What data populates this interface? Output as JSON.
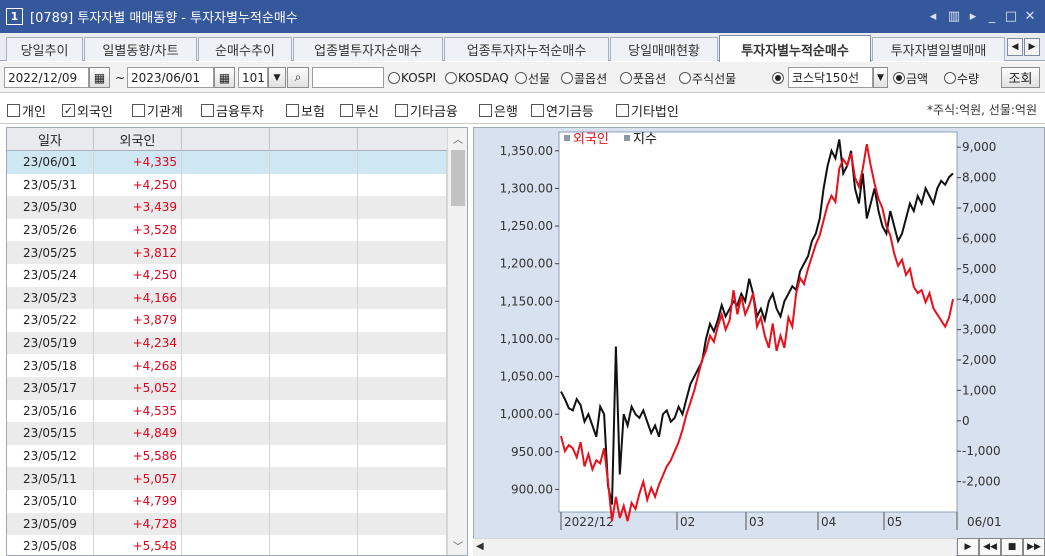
{
  "window": {
    "number": "1",
    "title": "[0789] 투자자별 매매동향 - 투자자별누적순매수",
    "controls": [
      "◂",
      "▥",
      "▸",
      "_",
      "□",
      "✕"
    ]
  },
  "tabs": [
    {
      "label": "당일추이",
      "active": false
    },
    {
      "label": "일별동향/차트",
      "active": false
    },
    {
      "label": "순매수추이",
      "active": false
    },
    {
      "label": "업종별투자자순매수",
      "active": false
    },
    {
      "label": "업종투자자누적순매수",
      "active": false
    },
    {
      "label": "당일매매현황",
      "active": false
    },
    {
      "label": "투자자별누적순매수",
      "active": true
    },
    {
      "label": "투자자별일별매매",
      "active": false
    }
  ],
  "toolbar": {
    "start_date": "2022/12/09",
    "tilde": "~",
    "end_date": "2023/06/01",
    "count": "101",
    "search_value": "",
    "radios": [
      {
        "label": "KOSPI",
        "checked": false
      },
      {
        "label": "KOSDAQ",
        "checked": false
      },
      {
        "label": "선물",
        "checked": false
      },
      {
        "label": "콜옵션",
        "checked": false
      },
      {
        "label": "풋옵션",
        "checked": false
      },
      {
        "label": "주식선물",
        "checked": false
      },
      {
        "label": "",
        "checked": true
      }
    ],
    "index_select": "코스닥150선",
    "mode_radios": [
      {
        "label": "금액",
        "checked": true
      },
      {
        "label": "수량",
        "checked": false
      }
    ],
    "query_button": "조회"
  },
  "filters": {
    "items": [
      {
        "label": "개인",
        "checked": false
      },
      {
        "label": "외국인",
        "checked": true
      },
      {
        "label": "기관계",
        "checked": false
      },
      {
        "label": "금융투자",
        "checked": false
      },
      {
        "label": "보험",
        "checked": false
      },
      {
        "label": "투신",
        "checked": false
      },
      {
        "label": "기타금융",
        "checked": false
      },
      {
        "label": "은행",
        "checked": false
      },
      {
        "label": "연기금등",
        "checked": false
      },
      {
        "label": "기타법인",
        "checked": false
      }
    ],
    "unit_note": "*주식:억원, 선물:억원"
  },
  "table": {
    "headers": [
      "일자",
      "외국인"
    ],
    "rows": [
      {
        "date": "23/06/01",
        "value": "+4,335"
      },
      {
        "date": "23/05/31",
        "value": "+4,250"
      },
      {
        "date": "23/05/30",
        "value": "+3,439"
      },
      {
        "date": "23/05/26",
        "value": "+3,528"
      },
      {
        "date": "23/05/25",
        "value": "+3,812"
      },
      {
        "date": "23/05/24",
        "value": "+4,250"
      },
      {
        "date": "23/05/23",
        "value": "+4,166"
      },
      {
        "date": "23/05/22",
        "value": "+3,879"
      },
      {
        "date": "23/05/19",
        "value": "+4,234"
      },
      {
        "date": "23/05/18",
        "value": "+4,268"
      },
      {
        "date": "23/05/17",
        "value": "+5,052"
      },
      {
        "date": "23/05/16",
        "value": "+4,535"
      },
      {
        "date": "23/05/15",
        "value": "+4,849"
      },
      {
        "date": "23/05/12",
        "value": "+5,586"
      },
      {
        "date": "23/05/11",
        "value": "+5,057"
      },
      {
        "date": "23/05/10",
        "value": "+4,799"
      },
      {
        "date": "23/05/09",
        "value": "+4,728"
      },
      {
        "date": "23/05/08",
        "value": "+5,548"
      }
    ]
  },
  "chart": {
    "legend": [
      {
        "label": "외국인",
        "color": "#e8101b"
      },
      {
        "label": "지수",
        "color": "#111111"
      }
    ],
    "left_ticks": [
      "1,350.00",
      "1,300.00",
      "1,250.00",
      "1,200.00",
      "1,150.00",
      "1,100.00",
      "1,050.00",
      "1,000.00",
      "950.00",
      "900.00"
    ],
    "right_ticks": [
      "9,000",
      "8,000",
      "7,000",
      "6,000",
      "5,000",
      "4,000",
      "3,000",
      "2,000",
      "1,000",
      "0",
      "-1,000",
      "-2,000"
    ],
    "x_ticks": [
      "2022/12",
      "02",
      "03",
      "04",
      "05",
      "06/01"
    ],
    "colors": {
      "bg": "#ffffff",
      "panel": "#d7e1ef",
      "foreign": "#e8101b",
      "index": "#111111"
    }
  },
  "chart_data": {
    "type": "line",
    "x": [
      "2022/12",
      "02",
      "03",
      "04",
      "05",
      "06/01"
    ],
    "yaxis_left": {
      "label": "",
      "ylim": [
        870,
        1375
      ]
    },
    "yaxis_right": {
      "label": "",
      "ylim": [
        -3000,
        9500
      ]
    },
    "series": [
      {
        "name": "지수",
        "axis": "left",
        "values": [
          1030,
          1020,
          1008,
          1005,
          1020,
          1012,
          990,
          1000,
          985,
          970,
          1010,
          1000,
          905,
          880,
          1090,
          920,
          1000,
          985,
          1010,
          1000,
          995,
          1005,
          990,
          975,
          985,
          970,
          1000,
          1005,
          990,
          995,
          1010,
          1000,
          1020,
          1040,
          1050,
          1060,
          1070,
          1100,
          1120,
          1110,
          1125,
          1145,
          1130,
          1140,
          1150,
          1145,
          1160,
          1150,
          1180,
          1160,
          1130,
          1140,
          1125,
          1150,
          1160,
          1140,
          1130,
          1150,
          1160,
          1170,
          1165,
          1190,
          1200,
          1210,
          1230,
          1240,
          1260,
          1300,
          1330,
          1350,
          1340,
          1365,
          1320,
          1330,
          1350,
          1300,
          1280,
          1320,
          1260,
          1280,
          1300,
          1270,
          1250,
          1240,
          1270,
          1250,
          1230,
          1240,
          1260,
          1280,
          1270,
          1290,
          1280,
          1300,
          1290,
          1280,
          1300,
          1310,
          1305,
          1315,
          1320
        ]
      },
      {
        "name": "외국인",
        "axis": "right",
        "values": [
          -500,
          -1000,
          -800,
          -900,
          -1200,
          -700,
          -1500,
          -1100,
          -1600,
          -1300,
          -1400,
          -900,
          -2000,
          -3300,
          -2500,
          -3200,
          -2800,
          -3300,
          -2700,
          -2900,
          -2400,
          -2000,
          -2600,
          -2200,
          -2500,
          -2100,
          -1800,
          -1500,
          -1300,
          -1000,
          -700,
          -300,
          200,
          600,
          1000,
          1500,
          2000,
          2300,
          2800,
          2600,
          3100,
          3500,
          3000,
          3300,
          4300,
          3500,
          4100,
          3500,
          3800,
          4200,
          3100,
          3400,
          2800,
          2400,
          3200,
          2300,
          2800,
          2400,
          3400,
          3100,
          4200,
          4700,
          4500,
          5000,
          5400,
          5800,
          6100,
          6600,
          7100,
          7400,
          7200,
          8300,
          8600,
          8400,
          8800,
          8000,
          7700,
          8300,
          9100,
          8400,
          7800,
          7300,
          7000,
          6400,
          6100,
          5500,
          5100,
          5300,
          4800,
          5000,
          4400,
          4200,
          4300,
          3900,
          4200,
          3700,
          3500,
          3300,
          3100,
          3400,
          4000
        ]
      }
    ]
  }
}
